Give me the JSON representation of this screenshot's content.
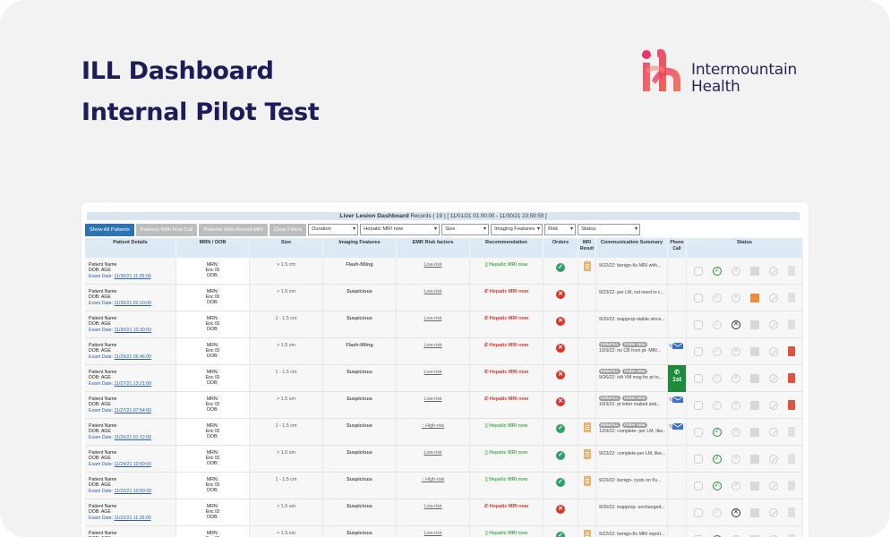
{
  "slide": {
    "title_line1": "ILL Dashboard",
    "title_line2": "Internal Pilot Test",
    "logo_line1": "Intermountain",
    "logo_line2": "Health",
    "colors": {
      "title": "#1e1b5b",
      "logo_gradient_start": "#e8336d",
      "logo_gradient_end": "#f15a3a",
      "background": "#f2f2f3"
    }
  },
  "dashboard": {
    "title": "Liver Lesion Dashboard",
    "records_info": "Records ( 19 ) [ 11/01/21 01:00:00 - 11/30/21 23:59:59 ]",
    "buttons": {
      "show_all": "Show All Patients",
      "first_call": "Patients With First Call",
      "recent_mri": "Patients With Recent MRI",
      "clear_filters": "Clear Filters"
    },
    "filters": {
      "duration": "Duration",
      "recommendation": "Hepatic MRI now",
      "size": "Size",
      "imaging_features": "Imaging Features",
      "risk": "Risk",
      "status": "Status"
    },
    "columns": {
      "patient_details": "Patient Details",
      "mrn_dob": "MRN / DOB",
      "size": "Size",
      "imaging_features": "Imaging Features",
      "emr_risk": "EMR Risk factors",
      "recommendation": "Recommendation",
      "orders": "Orders",
      "mri_result": "MRI Result",
      "comm_summary": "Communication Summary",
      "phone_call": "Phone Call",
      "status": "Status"
    },
    "patient_labels": {
      "name": "Patient Name",
      "dob": "DOB:",
      "age": "AGE",
      "exam": "Exam Date:",
      "mrn": "MRN:",
      "enc": "Enc ID",
      "dob2": "DOB:"
    },
    "rows": [
      {
        "exam_date": "11/30/21 11:05:00",
        "size": "> 1.5 cm",
        "feature": "Flash-filling",
        "risk": "Low-risk",
        "risk_high": false,
        "rec": "Hepatic MRI now",
        "rec_call": false,
        "order": "check",
        "mri": true,
        "comm": "9/22/22: benign-f/u MRI with...",
        "pills": [],
        "phone": "",
        "status": [
          "clock",
          "check-on",
          "x",
          "sq",
          "ban",
          "doc"
        ]
      },
      {
        "exam_date": "11/30/21 02:10:00",
        "size": "> 1.5 cm",
        "feature": "Suspicious",
        "risk": "Low-risk",
        "risk_high": false,
        "rec": "Hepatic MRI now",
        "rec_call": true,
        "order": "x",
        "mri": false,
        "comm": "9/23/22: per LM, nsl need to c...",
        "pills": [],
        "phone": "",
        "status": [
          "clock",
          "check",
          "x",
          "cal-orange",
          "ban",
          "doc"
        ]
      },
      {
        "exam_date": "11/30/21 10:30:00",
        "size": "1 - 1.5 cm",
        "feature": "Suspicious",
        "risk": "Low-risk",
        "risk_high": false,
        "rec": "Hepatic MRI now",
        "rec_call": true,
        "order": "x",
        "mri": false,
        "comm": "9/26/22: inapprop-stable since...",
        "pills": [],
        "phone": "",
        "status": [
          "clock",
          "check",
          "x-on",
          "sq",
          "ban",
          "doc"
        ]
      },
      {
        "exam_date": "11/29/21 06:46:00",
        "size": "> 1.5 cm",
        "feature": "Flash-filling",
        "risk": "Low-risk",
        "risk_high": false,
        "rec": "Hepatic MRI now",
        "rec_call": true,
        "order": "x",
        "mri": false,
        "comm": "10/3/22: no CB from pt- MRI...",
        "pills": [
          "Initial ILL",
          "Order nmu"
        ],
        "phone": "mail",
        "status": [
          "clock",
          "check",
          "x",
          "sq",
          "ban",
          "doc-red"
        ]
      },
      {
        "exam_date": "11/27/21 13:21:00",
        "size": "1 - 1.5 cm",
        "feature": "Suspicious",
        "risk": "Low-risk",
        "risk_high": false,
        "rec": "Hepatic MRI now",
        "rec_call": true,
        "order": "x",
        "mri": false,
        "comm": "9/26/22: left VM msg for pt to...",
        "pills": [
          "Initial ILL",
          "Order nmu"
        ],
        "phone": "first",
        "status": [
          "clock",
          "check",
          "x",
          "sq",
          "ban",
          "doc-red"
        ]
      },
      {
        "exam_date": "11/27/21 07:54:00",
        "size": "> 1.5 cm",
        "feature": "Suspicious",
        "risk": "Low-risk",
        "risk_high": false,
        "rec": "Hepatic MRI now",
        "rec_call": true,
        "order": "x",
        "mri": false,
        "comm": "10/3/22: pt letter mailed and...",
        "pills": [
          "Initial ILL",
          "Order nmu"
        ],
        "phone": "mail",
        "status": [
          "clock",
          "check",
          "x",
          "sq",
          "ban",
          "doc-red"
        ]
      },
      {
        "exam_date": "11/26/21 01:12:00",
        "size": "1 - 1.5 cm",
        "feature": "Suspicious",
        "risk": "High-risk",
        "risk_high": true,
        "rec": "Hepatic MRI now",
        "rec_call": false,
        "order": "check",
        "mri": true,
        "comm": "12/9/22: complete- per LM, like...",
        "pills": [
          "Initial ILL",
          "Order nmu"
        ],
        "phone": "mail",
        "status": [
          "clock",
          "check-on",
          "x",
          "sq",
          "ban",
          "doc"
        ]
      },
      {
        "exam_date": "11/24/21 10:50:00",
        "size": "> 1.5 cm",
        "feature": "Suspicious",
        "risk": "Low-risk",
        "risk_high": false,
        "rec": "Hepatic MRI now",
        "rec_call": false,
        "order": "check",
        "mri": true,
        "comm": "9/23/22: complete-per LM, like...",
        "pills": [],
        "phone": "",
        "status": [
          "clock",
          "check-on",
          "x",
          "sq",
          "ban",
          "doc"
        ]
      },
      {
        "exam_date": "11/22/21 10:50:00",
        "size": "1 - 1.5 cm",
        "feature": "Suspicious",
        "risk": "High-risk",
        "risk_high": true,
        "rec": "Hepatic MRI now",
        "rec_call": false,
        "order": "check",
        "mri": true,
        "comm": "9/23/22: benign- cysts on f/u...",
        "pills": [],
        "phone": "",
        "status": [
          "clock",
          "check-on",
          "x",
          "sq",
          "ban",
          "doc"
        ]
      },
      {
        "exam_date": "11/22/21 11:25:00",
        "size": "> 1.5 cm",
        "feature": "Suspicious",
        "risk": "Low-risk",
        "risk_high": false,
        "rec": "Hepatic MRI now",
        "rec_call": true,
        "order": "x",
        "mri": false,
        "comm": "9/26/22: inapprop- unchanged...",
        "pills": [],
        "phone": "",
        "status": [
          "clock",
          "check",
          "x-on",
          "sq",
          "ban",
          "doc"
        ]
      },
      {
        "exam_date": "",
        "size": "> 1.5 cm",
        "feature": "Suspicious",
        "risk": "Low-risk",
        "risk_high": false,
        "rec": "Hepatic MRI now",
        "rec_call": false,
        "order": "check",
        "mri": true,
        "comm": "9/22/22: benign-f/u MRI report...",
        "pills": [],
        "phone": "",
        "status": [
          "clock",
          "check-on",
          "x",
          "sq",
          "ban",
          "doc"
        ]
      }
    ]
  }
}
